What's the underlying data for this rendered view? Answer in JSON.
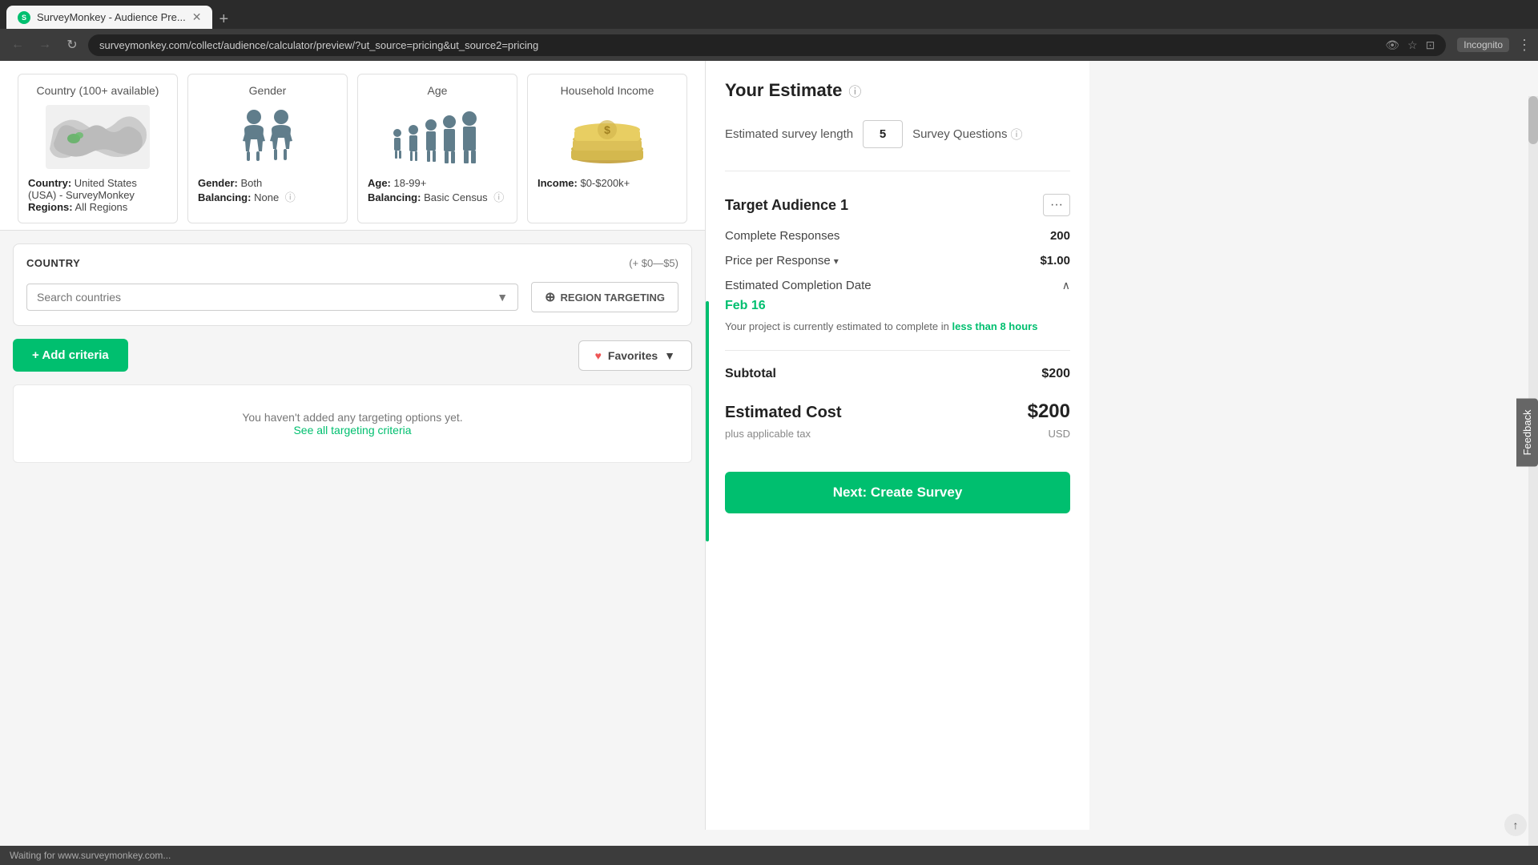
{
  "browser": {
    "tab_label": "SurveyMonkey - Audience Pre...",
    "url": "surveymonkey.com/collect/audience/calculator/preview/?ut_source=pricing&ut_source2=pricing",
    "incognito": "Incognito"
  },
  "cards": [
    {
      "title": "Country (100+ available)",
      "info_label": "Country:",
      "info_value": "United States (USA) - SurveyMonkey",
      "regions_label": "Regions:",
      "regions_value": "All Regions"
    },
    {
      "title": "Gender",
      "info_label1": "Gender:",
      "info_value1": "Both",
      "info_label2": "Balancing:",
      "info_value2": "None"
    },
    {
      "title": "Age",
      "info_label1": "Age:",
      "info_value1": "18-99+",
      "info_label2": "Balancing:",
      "info_value2": "Basic Census"
    },
    {
      "title": "Household Income",
      "info_label1": "Income:",
      "info_value1": "$0-$200k+"
    }
  ],
  "country_section": {
    "title": "COUNTRY",
    "price_range": "(+ $0—$5)",
    "search_placeholder": "Search countries",
    "region_btn_label": "REGION TARGETING"
  },
  "actions": {
    "add_criteria_label": "+ Add criteria",
    "favorites_label": "Favorites"
  },
  "empty_state": {
    "message": "You haven't added any targeting options yet.",
    "link_text": "See all targeting criteria"
  },
  "right_panel": {
    "your_estimate_title": "Your Estimate",
    "survey_length_label": "Estimated survey length",
    "question_count": "5",
    "survey_questions_label": "Survey Questions",
    "audience_title": "Target Audience 1",
    "complete_responses_label": "Complete Responses",
    "complete_responses_value": "200",
    "price_per_response_label": "Price per Response",
    "price_per_response_value": "$1.00",
    "completion_date_label": "Estimated Completion Date",
    "completion_date_value": "Feb 16",
    "completion_desc_prefix": "Your project is currently estimated to complete in",
    "completion_time": "less than 8 hours",
    "subtotal_label": "Subtotal",
    "subtotal_value": "$200",
    "estimated_cost_label": "Estimated Cost",
    "estimated_cost_value": "$200",
    "tax_label": "plus applicable tax",
    "currency_label": "USD",
    "create_btn_label": "Next: Create Survey"
  },
  "status_bar": {
    "text": "Waiting for www.surveymonkey.com..."
  }
}
